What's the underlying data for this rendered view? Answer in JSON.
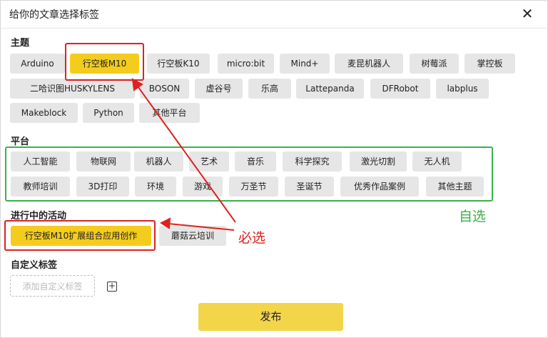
{
  "dialog": {
    "title": "给你的文章选择标签",
    "close_glyph": "✕"
  },
  "topic": {
    "heading": "主题",
    "tags": [
      "Arduino",
      "行空板M10",
      "行空板K10",
      "micro:bit",
      "Mind+",
      "麦昆机器人",
      "树莓派",
      "掌控板",
      "二哈识图HUSKYLENS",
      "BOSON",
      "虚谷号",
      "乐高",
      "Lattepanda",
      "DFRobot",
      "labplus",
      "Makeblock",
      "Python",
      "其他平台"
    ],
    "selected": "行空板M10"
  },
  "platform": {
    "heading": "平台",
    "tags": [
      "人工智能",
      "物联网",
      "机器人",
      "艺术",
      "音乐",
      "科学探究",
      "激光切割",
      "无人机",
      "教师培训",
      "3D打印",
      "环境",
      "游戏",
      "万圣节",
      "圣诞节",
      "优秀作品案例",
      "其他主题"
    ]
  },
  "activity": {
    "heading": "进行中的活动",
    "tags": [
      "行空板M10扩展组合应用创作",
      "蘑菇云培训"
    ],
    "selected": "行空板M10扩展组合应用创作"
  },
  "custom_tags": {
    "heading": "自定义标签",
    "placeholder": "添加自定义标签",
    "add_glyph": "+"
  },
  "publish_label": "发布",
  "annotations": {
    "required_note": "必选",
    "optional_note": "自选"
  },
  "colors": {
    "selected_tag": "#f3cc1e",
    "tag_bg": "#e6e6e6",
    "publish_bg": "#f3d54a",
    "red": "#e02020",
    "green": "#3bb14a"
  }
}
